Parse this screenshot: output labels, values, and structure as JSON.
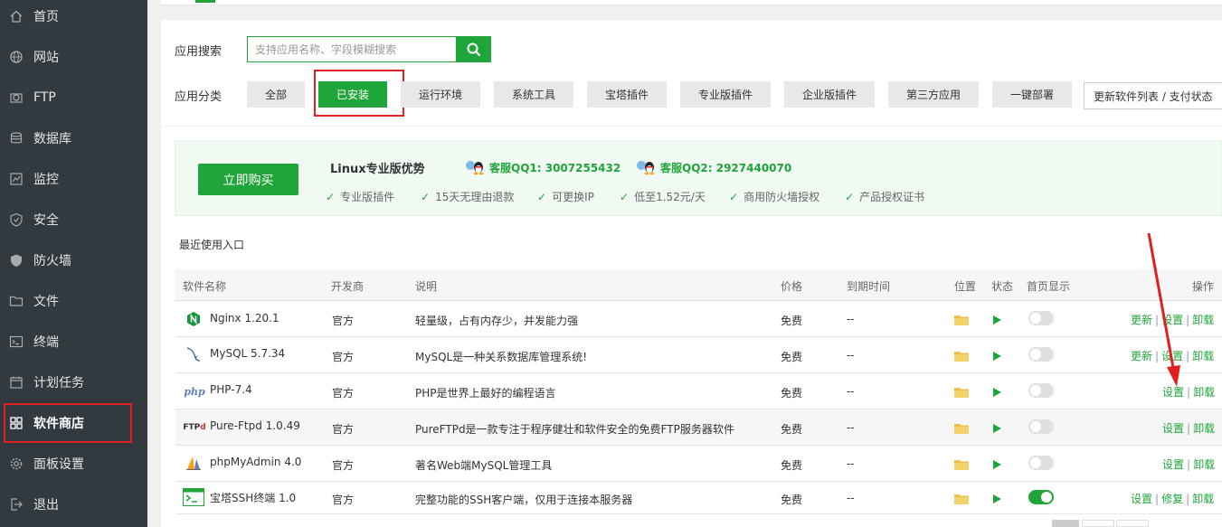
{
  "sidebar": {
    "items": [
      {
        "label": "首页",
        "icon": "home-icon"
      },
      {
        "label": "网站",
        "icon": "globe-icon"
      },
      {
        "label": "FTP",
        "icon": "ftp-icon"
      },
      {
        "label": "数据库",
        "icon": "database-icon"
      },
      {
        "label": "监控",
        "icon": "monitor-icon"
      },
      {
        "label": "安全",
        "icon": "shield-icon"
      },
      {
        "label": "防火墙",
        "icon": "firewall-icon"
      },
      {
        "label": "文件",
        "icon": "folder-icon"
      },
      {
        "label": "终端",
        "icon": "terminal-icon"
      },
      {
        "label": "计划任务",
        "icon": "calendar-icon"
      },
      {
        "label": "软件商店",
        "icon": "grid-icon"
      },
      {
        "label": "面板设置",
        "icon": "gear-icon"
      },
      {
        "label": "退出",
        "icon": "logout-icon"
      }
    ],
    "active": "软件商店"
  },
  "search": {
    "label": "应用搜索",
    "placeholder": "支持应用名称、字段模糊搜索"
  },
  "category": {
    "label": "应用分类",
    "buttons": [
      "全部",
      "已安装",
      "运行环境",
      "系统工具",
      "宝塔插件",
      "专业版插件",
      "企业版插件",
      "第三方应用",
      "一键部署"
    ],
    "active": "已安装",
    "refresh_label": "更新软件列表 / 支付状态"
  },
  "promo": {
    "buy_label": "立即购买",
    "title": "Linux专业版优势",
    "qq1": "客服QQ1: 3007255432",
    "qq2": "客服QQ2: 2927440070",
    "features": [
      "专业版插件",
      "15天无理由退款",
      "可更换IP",
      "低至1.52元/天",
      "商用防火墙授权",
      "产品授权证书"
    ]
  },
  "recent_label": "最近使用入口",
  "table": {
    "headers": [
      "软件名称",
      "开发商",
      "说明",
      "价格",
      "到期时间",
      "位置",
      "状态",
      "首页显示",
      "操作"
    ],
    "rows": [
      {
        "name": "Nginx 1.20.1",
        "vendor": "官方",
        "desc": "轻量级，占有内存少，并发能力强",
        "price": "免费",
        "expire": "--",
        "homepage": false,
        "ops": [
          "更新",
          "设置",
          "卸载"
        ],
        "icon": "nginx-icon"
      },
      {
        "name": "MySQL 5.7.34",
        "vendor": "官方",
        "desc": "MySQL是一种关系数据库管理系统!",
        "price": "免费",
        "expire": "--",
        "homepage": false,
        "ops": [
          "更新",
          "设置",
          "卸载"
        ],
        "icon": "mysql-icon"
      },
      {
        "name": "PHP-7.4",
        "vendor": "官方",
        "desc": "PHP是世界上最好的编程语言",
        "price": "免费",
        "expire": "--",
        "homepage": false,
        "ops": [
          "设置",
          "卸载"
        ],
        "icon": "php-icon"
      },
      {
        "name": "Pure-Ftpd 1.0.49",
        "vendor": "官方",
        "desc": "PureFTPd是一款专注于程序健壮和软件安全的免费FTP服务器软件",
        "price": "免费",
        "expire": "--",
        "homepage": false,
        "ops": [
          "设置",
          "卸载"
        ],
        "icon": "pureftpd-icon"
      },
      {
        "name": "phpMyAdmin 4.0",
        "vendor": "官方",
        "desc": "著名Web端MySQL管理工具",
        "price": "免费",
        "expire": "--",
        "homepage": false,
        "ops": [
          "设置",
          "卸载"
        ],
        "icon": "phpmyadmin-icon"
      },
      {
        "name": "宝塔SSH终端 1.0",
        "vendor": "官方",
        "desc": "完整功能的SSH客户端，仅用于连接本服务器",
        "price": "免费",
        "expire": "--",
        "homepage": true,
        "ops": [
          "设置",
          "修复",
          "卸载"
        ],
        "icon": "ssh-terminal-icon"
      }
    ]
  },
  "colors": {
    "accent": "#20a53a",
    "sidebar_bg": "#333a3f",
    "highlight": "#e02020"
  }
}
